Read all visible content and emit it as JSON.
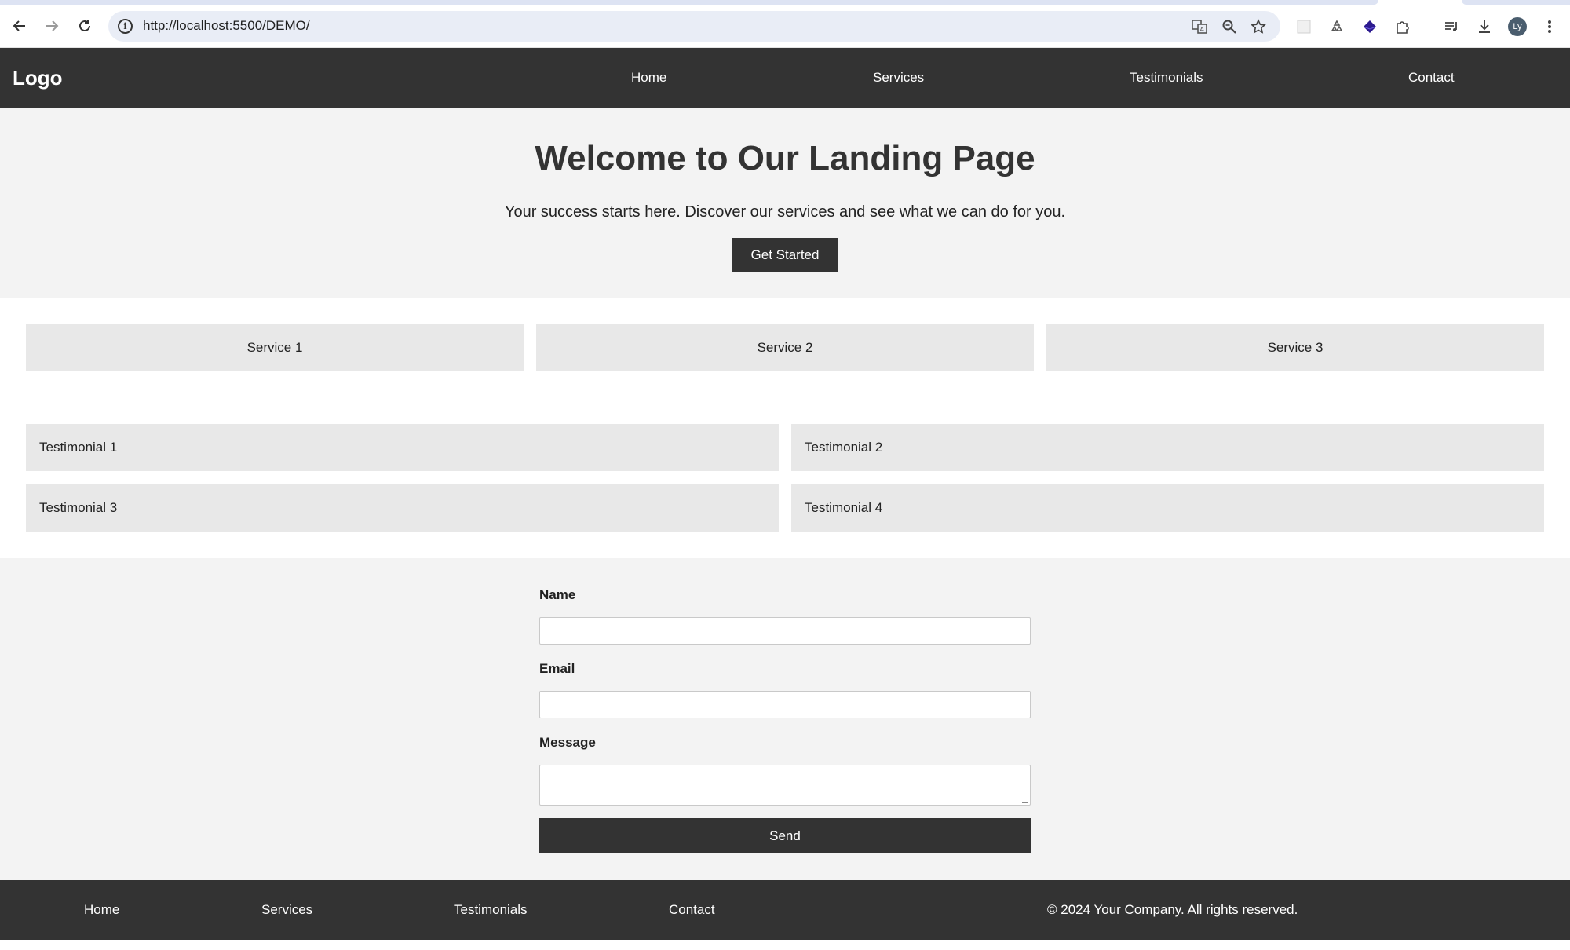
{
  "browser": {
    "url": "http://localhost:5500/DEMO/",
    "avatar_initials": "Ly",
    "icons": [
      "back-arrow-icon",
      "forward-arrow-icon",
      "reload-icon",
      "site-info-icon",
      "translate-icon",
      "zoom-icon",
      "bookmark-star-icon",
      "extension-icon",
      "recycle-icon",
      "gem-icon",
      "puzzle-icon",
      "media-queue-icon",
      "download-icon",
      "more-menu-icon"
    ]
  },
  "header": {
    "logo": "Logo",
    "nav": [
      "Home",
      "Services",
      "Testimonials",
      "Contact"
    ]
  },
  "hero": {
    "title": "Welcome to Our Landing Page",
    "subtitle": "Your success starts here. Discover our services and see what we can do for you.",
    "cta": "Get Started"
  },
  "services": [
    "Service 1",
    "Service 2",
    "Service 3"
  ],
  "testimonials": [
    "Testimonial 1",
    "Testimonial 2",
    "Testimonial 3",
    "Testimonial 4"
  ],
  "contact": {
    "name_label": "Name",
    "name_value": "",
    "email_label": "Email",
    "email_value": "",
    "message_label": "Message",
    "message_value": "",
    "send": "Send"
  },
  "footer": {
    "nav": [
      "Home",
      "Services",
      "Testimonials",
      "Contact"
    ],
    "copyright": "© 2024 Your Company. All rights reserved."
  },
  "colors": {
    "header_bg": "#333333",
    "hero_bg": "#f3f3f3",
    "card_bg": "#e8e8e8",
    "accent": "#333333"
  }
}
